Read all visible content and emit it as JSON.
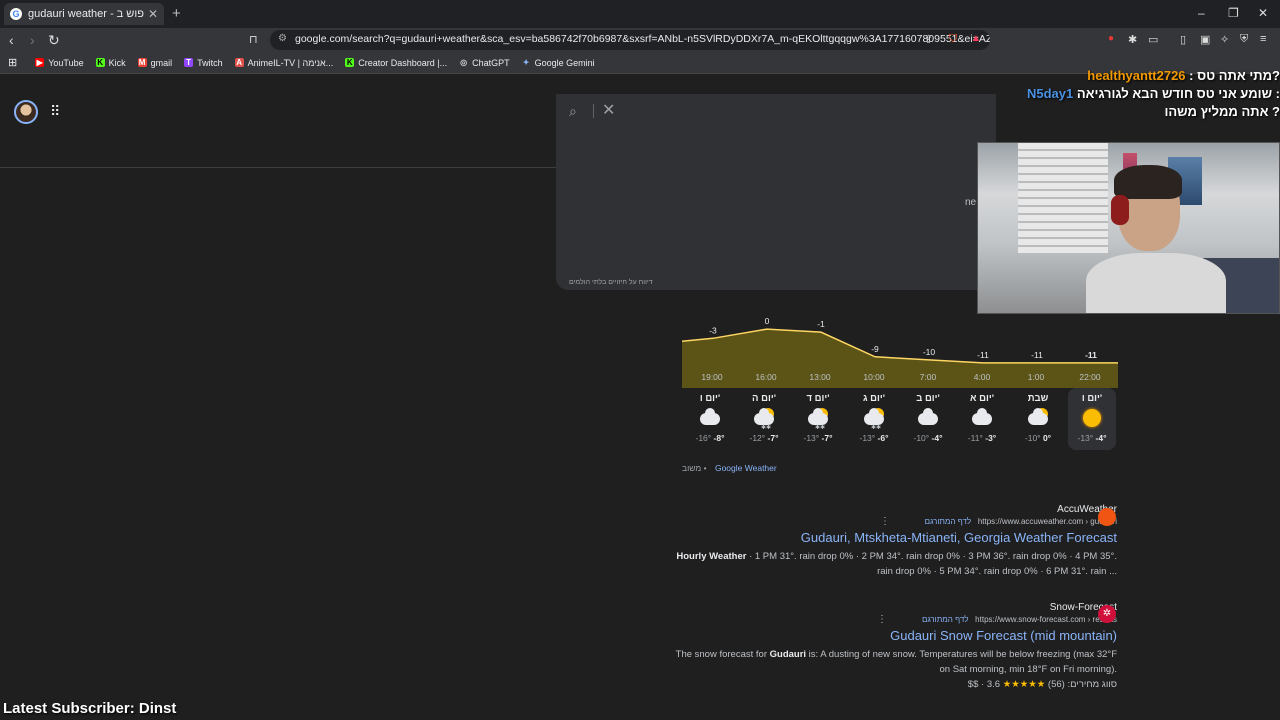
{
  "browser": {
    "tab_title": "gudauri weather - חיפוש ב-Goo",
    "new_tab": "+",
    "tab_close": "✕",
    "url": "google.com/search?q=gudauri+weather&sca_esv=ba586742f70b6987&sxsrf=ANbL-n5SVlRDyDDXr7A_m-qEKOlttgqqgw%3A1771607809551&ei=AZ...",
    "window_minimize": "–",
    "window_restore": "❐",
    "window_close": "✕"
  },
  "bookmarks": [
    {
      "label": "YouTube",
      "color": "#ff0000",
      "glyph": "▶"
    },
    {
      "label": "Kick",
      "color": "#53fc18",
      "glyph": "K"
    },
    {
      "label": "gmail",
      "color": "#ea4335",
      "glyph": "M"
    },
    {
      "label": "Twitch",
      "color": "#9146ff",
      "glyph": "T"
    },
    {
      "label": "AnimeIL-TV | אנימה...",
      "color": "#e2504c",
      "glyph": "A"
    },
    {
      "label": "Creator Dashboard |...",
      "color": "#53fc18",
      "glyph": "K"
    },
    {
      "label": "ChatGPT",
      "color": "#bbbbbb",
      "glyph": "◎"
    },
    {
      "label": "Google Gemini",
      "color": "#8ab4f8",
      "glyph": "✦"
    }
  ],
  "search": {
    "hint_text": "ne",
    "footer": "דיווח על חיזויים בלתי הולמים"
  },
  "chart_data": {
    "type": "area",
    "title": "",
    "x": [
      "22:00",
      "1:00",
      "4:00",
      "7:00",
      "10:00",
      "13:00",
      "16:00",
      "19:00"
    ],
    "values": [
      -11,
      -11,
      -11,
      -10,
      -9,
      -1,
      0,
      -3
    ],
    "point_labels": [
      "-11",
      "-11",
      "-11",
      "-10",
      "-9",
      "-1",
      "0",
      "-3"
    ],
    "xlabel": "",
    "ylabel": "",
    "unit": "°C",
    "fill_color": "#5c5416",
    "line_color": "#fdd663",
    "direction": "rtl"
  },
  "forecast": [
    {
      "day": "יום ו'",
      "icon": "sun",
      "low": "-13°",
      "high": "-4°",
      "selected": true
    },
    {
      "day": "שבת",
      "icon": "partly-sunny",
      "low": "-10°",
      "high": "0°",
      "selected": false
    },
    {
      "day": "יום א'",
      "icon": "cloud",
      "low": "-11°",
      "high": "-3°",
      "selected": false
    },
    {
      "day": "יום ב'",
      "icon": "cloud",
      "low": "-10°",
      "high": "-4°",
      "selected": false
    },
    {
      "day": "יום ג'",
      "icon": "snow-sun",
      "low": "-13°",
      "high": "-6°",
      "selected": false
    },
    {
      "day": "יום ד'",
      "icon": "snow-sun",
      "low": "-13°",
      "high": "-7°",
      "selected": false
    },
    {
      "day": "יום ה'",
      "icon": "snow-sun",
      "low": "-12°",
      "high": "-7°",
      "selected": false
    },
    {
      "day": "יום ו'",
      "icon": "cloud",
      "low": "-16°",
      "high": "-8°",
      "selected": false
    }
  ],
  "weather_footer": {
    "source": "Google Weather",
    "feedback": "משוב"
  },
  "results": [
    {
      "source": "AccuWeather",
      "url": "https://www.accuweather.com › gudauri",
      "translate": "לדף המתורגם",
      "title": "Gudauri, Mtskheta-Mtianeti, Georgia Weather Forecast",
      "snippet_bold": "Hourly Weather",
      "snippet_line1": " · 1 PM 31°. rain drop 0% · 2 PM 34°. rain drop 0% · 3 PM 36°. rain drop 0% · 4 PM 35°.",
      "snippet_line2": "rain drop 0% · 5 PM 34°. rain drop 0% · 6 PM 31°. rain ..."
    },
    {
      "source": "Snow-Forecast",
      "url": "https://www.snow-forecast.com › resorts",
      "translate": "לדף המתורגם",
      "title": "Gudauri Snow Forecast (mid mountain)",
      "snippet_line1_pre": "The snow forecast for ",
      "snippet_bold": "Gudauri",
      "snippet_line1_post": " is: A dusting of new snow. Temperatures will be below freezing (max 32°F",
      "snippet_line2": "on Sat morning, min 18°F on Fri morning).",
      "rating": "3.6",
      "reviews": "(56)",
      "rating_label": "סווג מחירים:",
      "price": "$$"
    }
  ],
  "stream": {
    "chat": [
      {
        "user": "healthyantt2726",
        "msg": "מתי אתה טס?",
        "user_color": "#f29900"
      },
      {
        "user": "N5day1",
        "msg": "שומע אני טס חודש הבא לגורגיאה :",
        "user_color": "#4a90e2"
      },
      {
        "user": "",
        "msg": "אתה ממליץ משהו ?",
        "user_color": "#ffffff"
      }
    ],
    "latest_subscriber": "Latest Subscriber: Dinst"
  }
}
